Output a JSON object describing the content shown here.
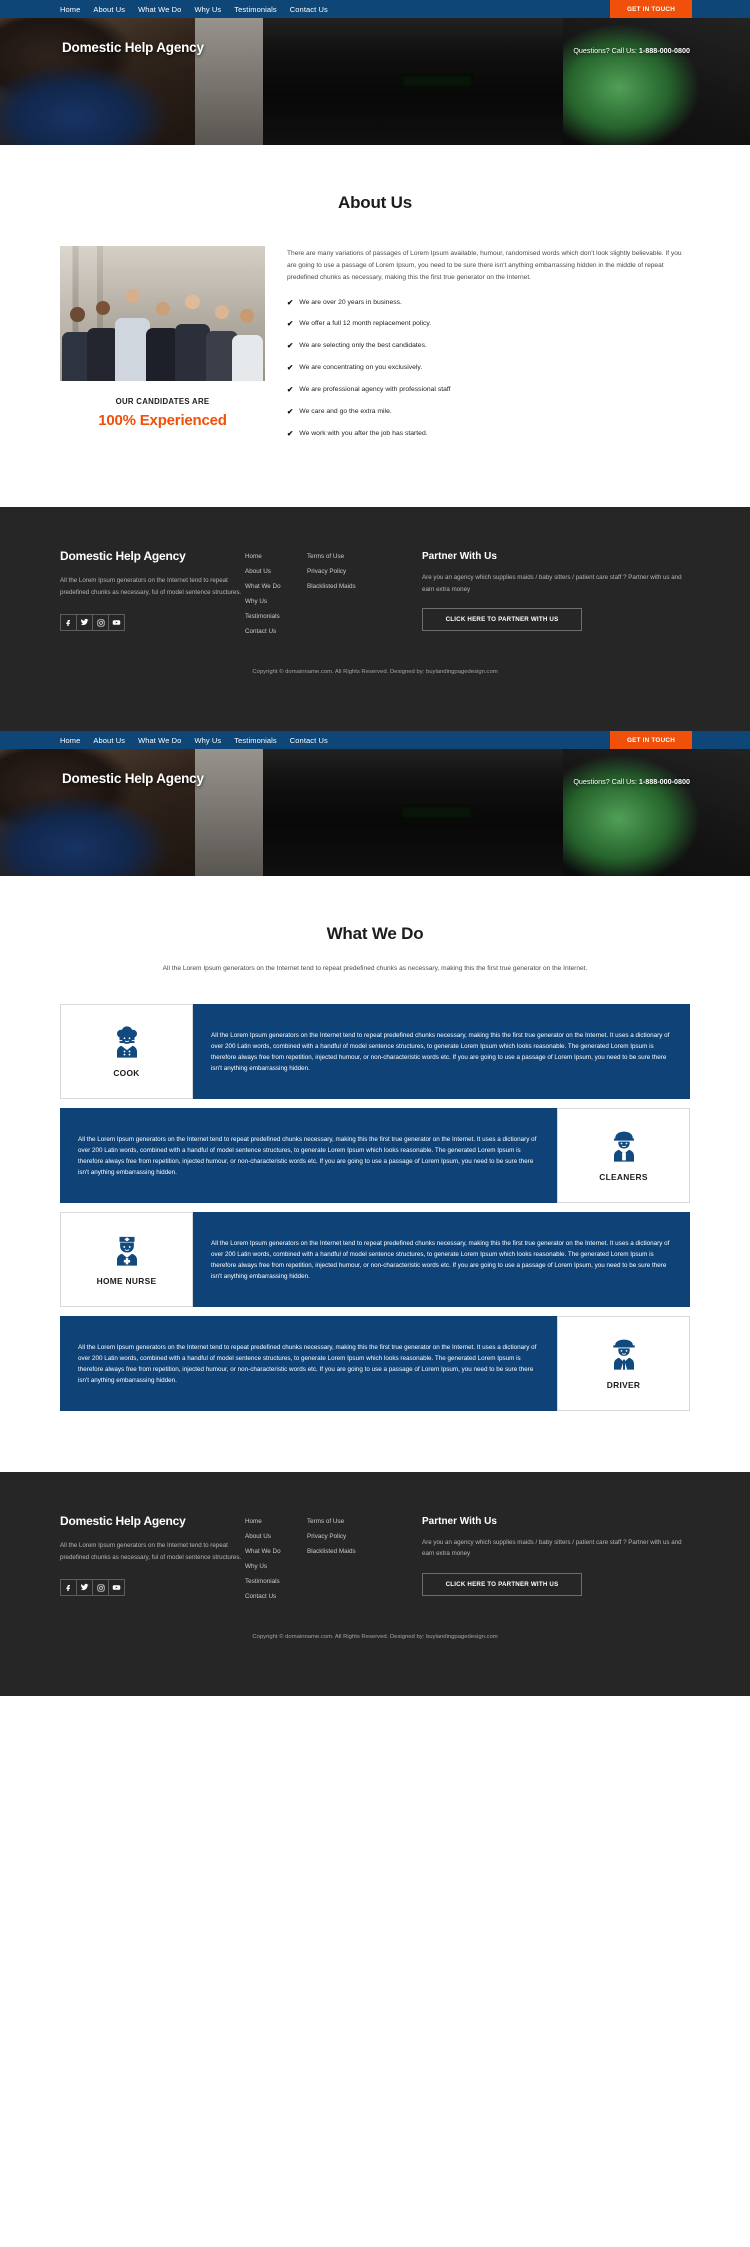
{
  "nav": {
    "links": [
      "Home",
      "About Us",
      "What We Do",
      "Why Us",
      "Testimonials",
      "Contact Us"
    ],
    "cta_label": "GET IN TOUCH"
  },
  "hero": {
    "brand": "Domestic Help Agency",
    "phone_prefix": "Questions? Call Us: ",
    "phone_number": "1-888-000-0800"
  },
  "about": {
    "title": "About Us",
    "paragraph": "There are many variations of passages of Lorem Ipsum available, humour, randomised words which don't look slightly believable. If you are going to use a passage of Lorem Ipsum, you need to be sure there isn't anything embarrassing hidden in the middle of repeat predefined chunks as necessary, making this the first true generator on the Internet.",
    "caption_small": "OUR CANDIDATES ARE",
    "caption_highlight": "100% Experienced",
    "highlight_color": "#f1500b",
    "bullets": [
      "We are over 20 years in business.",
      "We offer a full 12 month replacement policy.",
      "We are selecting only the best candidates.",
      "We are concentrating on you exclusively.",
      "We are professional agency with professional staff",
      "We care and go the extra mile.",
      "We work with you after the job has started."
    ]
  },
  "whatwedo": {
    "title": "What We Do",
    "subtitle": "All the Lorem Ipsum generators on the Internet tend to repeat predefined chunks as necessary, making this the first true generator on the Internet.",
    "card_text": "All the Lorem Ipsum generators on the Internet tend to repeat predefined chunks necessary, making this the first true generator on the Internet. It uses a dictionary of over 200 Latin words, combined with a handful of model sentence structures, to generate Lorem Ipsum which looks reasonable. The generated Lorem Ipsum is therefore always free from repetition, injected humour, or non-characteristic words etc. If you are going to use a passage of Lorem Ipsum, you need to be sure there isn't anything embarrassing hidden.",
    "services": [
      {
        "label": "COOK",
        "icon": "chef-icon",
        "icon_side": "left"
      },
      {
        "label": "CLEANERS",
        "icon": "cleaner-icon",
        "icon_side": "right"
      },
      {
        "label": "HOME NURSE",
        "icon": "nurse-icon",
        "icon_side": "left"
      },
      {
        "label": "DRIVER",
        "icon": "driver-icon",
        "icon_side": "right"
      }
    ],
    "accent_color": "#0f4377"
  },
  "footer": {
    "brand": "Domestic Help Agency",
    "description": "All the Lorem Ipsum generators on the Internet tend to repeat predefined chunks as necessary, ful of model sentence structures.",
    "socials": [
      "facebook-icon",
      "twitter-icon",
      "instagram-icon",
      "youtube-icon"
    ],
    "links_col1": [
      "Home",
      "About Us",
      "What We Do",
      "Why Us",
      "Testimonials",
      "Contact Us"
    ],
    "links_col2": [
      "Terms of Use",
      "Privacy Policy",
      "Blacklisted Maids"
    ],
    "partner_title": "Partner With Us",
    "partner_desc": "Are you an agency which supplies maids / baby sitters / patient care staff ? Partner with us and earn extra money",
    "partner_btn": "CLICK HERE TO PARTNER WITH US",
    "copyright": "Copyright © domainname.com. All Rights Reserved. Designed by: buylandingpagedesign.com"
  }
}
